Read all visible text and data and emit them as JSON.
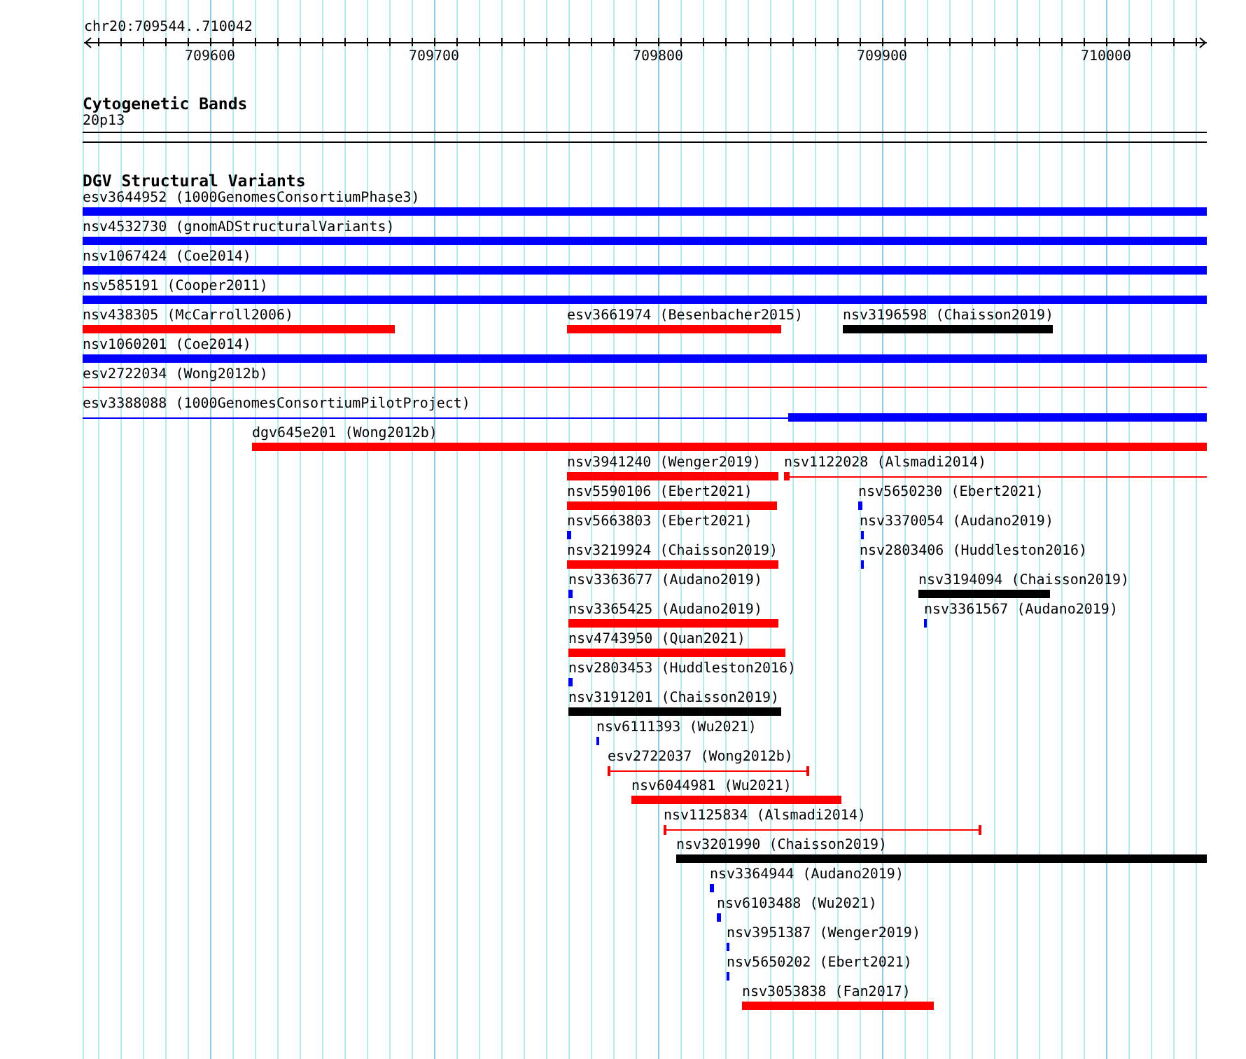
{
  "ruler": {
    "location": "chr20:709544..710042",
    "ticks": [
      "709600",
      "709700",
      "709800",
      "709900",
      "710000"
    ]
  },
  "cytogenetic_bands": {
    "title": "Cytogenetic Bands",
    "band": "20p13"
  },
  "dgv": {
    "title": "DGV Structural Variants",
    "rows": [
      {
        "features": [
          {
            "label": "esv3644952 (1000GenomesConsortiumPhase3)",
            "color": "#0000ff",
            "kind": "thick"
          }
        ]
      },
      {
        "features": [
          {
            "label": "nsv4532730 (gnomADStructuralVariants)",
            "color": "#0000ff",
            "kind": "thick"
          }
        ]
      },
      {
        "features": [
          {
            "label": "nsv1067424 (Coe2014)",
            "color": "#0000ff",
            "kind": "thick"
          }
        ]
      },
      {
        "features": [
          {
            "label": "nsv585191 (Cooper2011)",
            "color": "#0000ff",
            "kind": "thick"
          }
        ]
      },
      {
        "features": [
          {
            "label": "nsv438305 (McCarroll2006)",
            "color": "#ff0000",
            "kind": "thick"
          },
          {
            "label": "esv3661974 (Besenbacher2015)",
            "color": "#ff0000",
            "kind": "thick"
          },
          {
            "label": "nsv3196598 (Chaisson2019)",
            "color": "#000000",
            "kind": "thick"
          }
        ]
      },
      {
        "features": [
          {
            "label": "nsv1060201 (Coe2014)",
            "color": "#0000ff",
            "kind": "thick"
          }
        ]
      },
      {
        "features": [
          {
            "label": "esv2722034 (Wong2012b)",
            "color": "#ff0000",
            "kind": "thin"
          }
        ]
      },
      {
        "features": [
          {
            "label": "esv3388088 (1000GenomesConsortiumPilotProject)",
            "color": "#0000ff",
            "kind": "thin-thick"
          }
        ]
      },
      {
        "features": [
          {
            "label": "dgv645e201 (Wong2012b)",
            "color": "#ff0000",
            "kind": "thick"
          }
        ]
      },
      {
        "features": [
          {
            "label": "nsv3941240 (Wenger2019)",
            "color": "#ff0000",
            "kind": "thick"
          },
          {
            "label": "nsv1122028 (Alsmadi2014)",
            "color": "#ff0000",
            "kind": "thick-thin"
          }
        ]
      },
      {
        "features": [
          {
            "label": "nsv5590106 (Ebert2021)",
            "color": "#ff0000",
            "kind": "thick"
          },
          {
            "label": "nsv5650230 (Ebert2021)",
            "color": "#0000ff",
            "kind": "thick"
          }
        ]
      },
      {
        "features": [
          {
            "label": "nsv5663803 (Ebert2021)",
            "color": "#0000ff",
            "kind": "thick"
          },
          {
            "label": "nsv3370054 (Audano2019)",
            "color": "#0000ff",
            "kind": "thick"
          }
        ]
      },
      {
        "features": [
          {
            "label": "nsv3219924 (Chaisson2019)",
            "color": "#ff0000",
            "kind": "thick"
          },
          {
            "label": "nsv2803406 (Huddleston2016)",
            "color": "#0000ff",
            "kind": "thick"
          }
        ]
      },
      {
        "features": [
          {
            "label": "nsv3363677 (Audano2019)",
            "color": "#0000ff",
            "kind": "thick"
          },
          {
            "label": "nsv3194094 (Chaisson2019)",
            "color": "#000000",
            "kind": "thick"
          }
        ]
      },
      {
        "features": [
          {
            "label": "nsv3365425 (Audano2019)",
            "color": "#ff0000",
            "kind": "thick"
          },
          {
            "label": "nsv3361567 (Audano2019)",
            "color": "#0000ff",
            "kind": "thick"
          }
        ]
      },
      {
        "features": [
          {
            "label": "nsv4743950 (Quan2021)",
            "color": "#ff0000",
            "kind": "thick"
          }
        ]
      },
      {
        "features": [
          {
            "label": "nsv2803453 (Huddleston2016)",
            "color": "#0000ff",
            "kind": "thick"
          }
        ]
      },
      {
        "features": [
          {
            "label": "nsv3191201 (Chaisson2019)",
            "color": "#000000",
            "kind": "thick"
          }
        ]
      },
      {
        "features": [
          {
            "label": "nsv6111393 (Wu2021)",
            "color": "#0000ff",
            "kind": "thick"
          }
        ]
      },
      {
        "features": [
          {
            "label": "esv2722037 (Wong2012b)",
            "color": "#ff0000",
            "kind": "bracket"
          }
        ]
      },
      {
        "features": [
          {
            "label": "nsv6044981 (Wu2021)",
            "color": "#ff0000",
            "kind": "thick"
          }
        ]
      },
      {
        "features": [
          {
            "label": "nsv1125834 (Alsmadi2014)",
            "color": "#ff0000",
            "kind": "bracket"
          }
        ]
      },
      {
        "features": [
          {
            "label": "nsv3201990 (Chaisson2019)",
            "color": "#000000",
            "kind": "thick"
          }
        ]
      },
      {
        "features": [
          {
            "label": "nsv3364944 (Audano2019)",
            "color": "#0000ff",
            "kind": "thick"
          }
        ]
      },
      {
        "features": [
          {
            "label": "nsv6103488 (Wu2021)",
            "color": "#0000ff",
            "kind": "thick"
          }
        ]
      },
      {
        "features": [
          {
            "label": "nsv3951387 (Wenger2019)",
            "color": "#0000ff",
            "kind": "thick"
          }
        ]
      },
      {
        "features": [
          {
            "label": "nsv5650202 (Ebert2021)",
            "color": "#0000ff",
            "kind": "thick"
          }
        ]
      },
      {
        "features": [
          {
            "label": "nsv3053838 (Fan2017)",
            "color": "#ff0000",
            "kind": "thick"
          }
        ]
      }
    ]
  }
}
